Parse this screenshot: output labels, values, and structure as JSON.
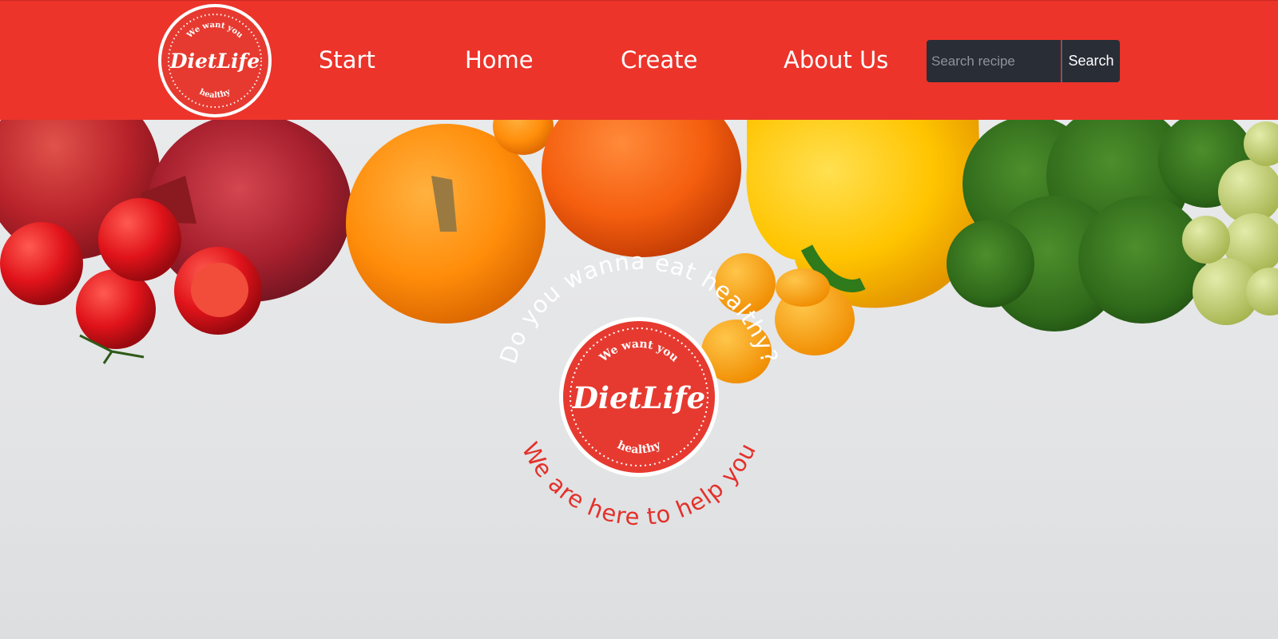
{
  "header": {
    "logo": {
      "top_text": "We want you",
      "name": "DietLife",
      "bottom_text": "healthy"
    },
    "nav": [
      {
        "label": "Start"
      },
      {
        "label": "Home"
      },
      {
        "label": "Create"
      },
      {
        "label": "About Us"
      }
    ],
    "search": {
      "placeholder": "Search recipe",
      "value": "",
      "button_label": "Search"
    }
  },
  "hero": {
    "badge": {
      "top_text": "We want you",
      "name": "DietLife",
      "bottom_text": "healthy",
      "arc_top": "Do you wanna eat healthy?",
      "arc_bottom": "We are here to help you"
    }
  },
  "colors": {
    "brand_red": "#ec342b",
    "search_bg": "#292d36",
    "white": "#ffffff"
  }
}
